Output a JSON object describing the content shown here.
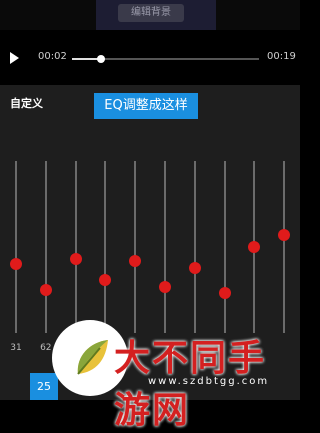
{
  "video": {
    "edit_background_label": "编辑背景"
  },
  "player": {
    "current_time": "00:02",
    "total_time": "00:19",
    "progress": 0.153
  },
  "eq": {
    "preset_name": "自定义",
    "tip_banner": "EQ调整成这样",
    "bands": [
      {
        "freq": "31",
        "level": 0.4
      },
      {
        "freq": "62",
        "level": 0.25
      },
      {
        "freq": "",
        "level": 0.43
      },
      {
        "freq": "",
        "level": 0.31
      },
      {
        "freq": "",
        "level": 0.42
      },
      {
        "freq": "",
        "level": 0.27
      },
      {
        "freq": "",
        "level": 0.38
      },
      {
        "freq": "",
        "level": 0.23
      },
      {
        "freq": "",
        "level": 0.5
      },
      {
        "freq": "",
        "level": 0.57
      }
    ],
    "selected_tile_text": "25"
  },
  "watermark": {
    "title": "大不同手游网",
    "url": "www.szdbtgg.com"
  },
  "colors": {
    "accent_blue": "#1a8fe0",
    "knob_red": "#e01b1b",
    "panel": "#1e1e1e"
  }
}
